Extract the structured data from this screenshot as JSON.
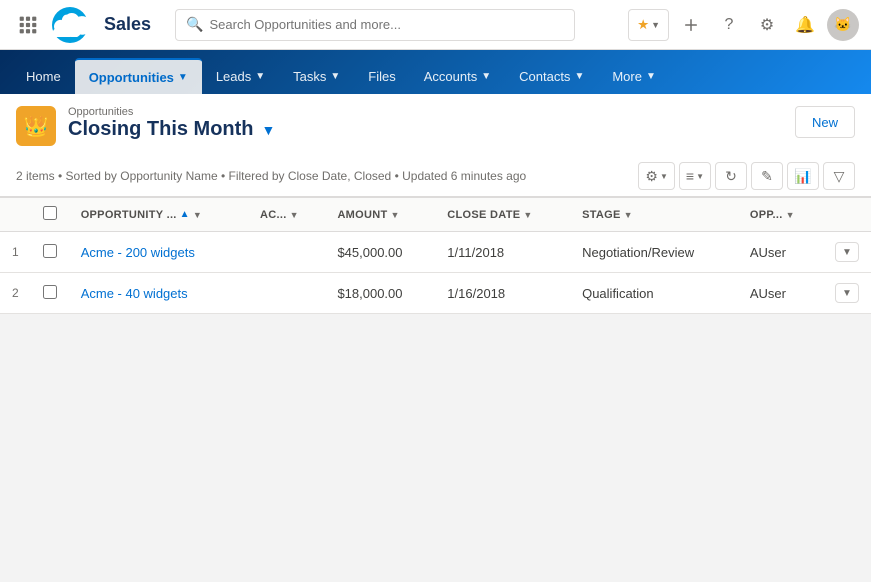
{
  "app": {
    "name": "Sales",
    "logo_text": "☁"
  },
  "search": {
    "placeholder": "Search Opportunities and more..."
  },
  "nav_icons": {
    "favorites_star": "★",
    "add": "+",
    "help": "?",
    "settings": "⚙",
    "notifications": "🔔",
    "avatar": "😺"
  },
  "tabs": [
    {
      "id": "home",
      "label": "Home",
      "active": false,
      "has_chevron": false
    },
    {
      "id": "opportunities",
      "label": "Opportunities",
      "active": true,
      "has_chevron": true
    },
    {
      "id": "leads",
      "label": "Leads",
      "active": false,
      "has_chevron": true
    },
    {
      "id": "tasks",
      "label": "Tasks",
      "active": false,
      "has_chevron": true
    },
    {
      "id": "files",
      "label": "Files",
      "active": false,
      "has_chevron": false
    },
    {
      "id": "accounts",
      "label": "Accounts",
      "active": false,
      "has_chevron": true
    },
    {
      "id": "contacts",
      "label": "Contacts",
      "active": false,
      "has_chevron": true
    },
    {
      "id": "more",
      "label": "More",
      "active": false,
      "has_chevron": true
    }
  ],
  "list_view": {
    "subtitle": "Opportunities",
    "title": "Closing This Month",
    "new_button_label": "New",
    "filter_info": "2 items • Sorted by Opportunity Name • Filtered by Close Date, Closed • Updated 6 minutes ago"
  },
  "table": {
    "columns": [
      {
        "id": "row_num",
        "label": ""
      },
      {
        "id": "checkbox",
        "label": ""
      },
      {
        "id": "opportunity_name",
        "label": "OPPORTUNITY ...",
        "sortable": true
      },
      {
        "id": "account",
        "label": "AC...",
        "sortable": false
      },
      {
        "id": "amount",
        "label": "AMOUNT",
        "sortable": false
      },
      {
        "id": "close_date",
        "label": "CLOSE DATE",
        "sortable": false
      },
      {
        "id": "stage",
        "label": "STAGE",
        "sortable": false
      },
      {
        "id": "opp_owner",
        "label": "OPP...",
        "sortable": false
      }
    ],
    "rows": [
      {
        "num": "1",
        "opportunity_name": "Acme - 200 widgets",
        "account": "",
        "amount": "$45,000.00",
        "close_date": "1/11/2018",
        "stage": "Negotiation/Review",
        "opp_owner": "AUser"
      },
      {
        "num": "2",
        "opportunity_name": "Acme - 40 widgets",
        "account": "",
        "amount": "$18,000.00",
        "close_date": "1/16/2018",
        "stage": "Qualification",
        "opp_owner": "AUser"
      }
    ]
  }
}
